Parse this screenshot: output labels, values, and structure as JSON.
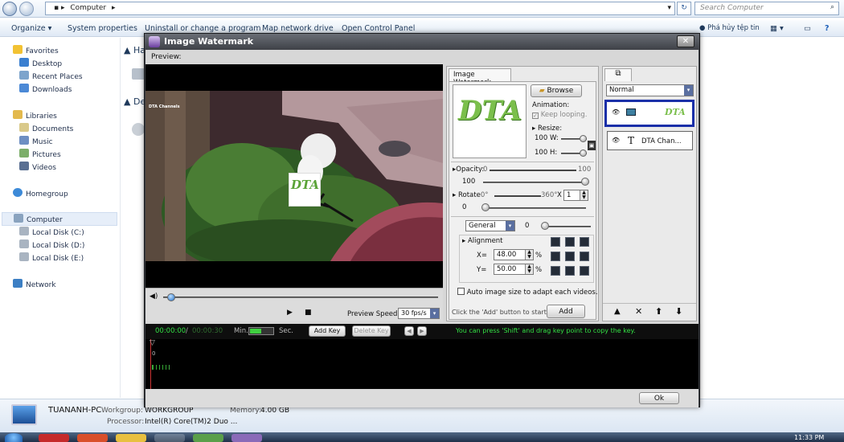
{
  "explorer": {
    "address": "Computer",
    "search_placeholder": "Search Computer",
    "commands": [
      "Organize ▾",
      "System properties",
      "Uninstall or change a program",
      "Map network drive",
      "Open Control Panel"
    ],
    "user_cmd": "Phá hủy tệp tin",
    "favorites": [
      "Favorites",
      "Desktop",
      "Recent Places",
      "Downloads"
    ],
    "libraries": [
      "Libraries",
      "Documents",
      "Music",
      "Pictures",
      "Videos"
    ],
    "homegroup": "Homegroup",
    "computer": [
      "Computer",
      "Local Disk (C:)",
      "Local Disk (D:)",
      "Local Disk (E:)"
    ],
    "network": "Network",
    "main_headers": [
      "Ha",
      "De"
    ],
    "details": {
      "pc_name": "TUANANH-PC",
      "workgroup_label": "Workgroup:",
      "workgroup": "WORKGROUP",
      "memory_label": "Memory:",
      "memory": "4.00 GB",
      "processor_label": "Processor:",
      "processor": "Intel(R) Core(TM)2 Duo ..."
    },
    "clock": "11:33 PM"
  },
  "dialog": {
    "title": "Image Watermark",
    "preview_label": "Preview:",
    "video_overlay_text": "DTA Channels",
    "watermark_text": "DTA",
    "playback": {
      "speed_label": "Preview Speed:",
      "speed_value": "30 fps/s",
      "position_fraction": 0.02
    },
    "watermark": {
      "tab": "Image Watermark",
      "browse": "Browse",
      "animation_label": "Animation:",
      "keep_looping": "Keep looping.",
      "resize_label": "Resize:",
      "w_value": "100",
      "w_label": "W:",
      "h_value": "100",
      "h_label": "H:",
      "opacity_label": "Opacity:",
      "opacity_min": "0",
      "opacity_max": "100",
      "opacity_value": "100",
      "rotate_label": "Rotate",
      "rotate_min": ":0°",
      "rotate_max": "360°",
      "rotate_x": "X",
      "rotate_count": "1",
      "rotate_value": "0",
      "blend_mode": "General",
      "blend_value": "0",
      "alignment_label": "Alignment",
      "x_label": "X=",
      "x_value": "48.00",
      "y_label": "Y=",
      "y_value": "50.00",
      "percent": "%",
      "auto_size": "Auto image size to adapt each videos.",
      "hint": "Click the 'Add' button to start ->",
      "add": "Add"
    },
    "layers": {
      "mode": "Normal",
      "items": [
        {
          "label": "DTA"
        },
        {
          "label": "DTA Chan..."
        }
      ]
    },
    "keys": {
      "time_current": "00:00:00",
      "time_sep": "/",
      "time_total": "00:00:30",
      "min_label": "Min.",
      "sec_label": "Sec.",
      "add_key": "Add Key",
      "delete_key": "Delete Key",
      "hint": "You can press 'Shift' and drag key point to copy the key.",
      "timeline_zero": "0"
    },
    "ok": "Ok"
  }
}
